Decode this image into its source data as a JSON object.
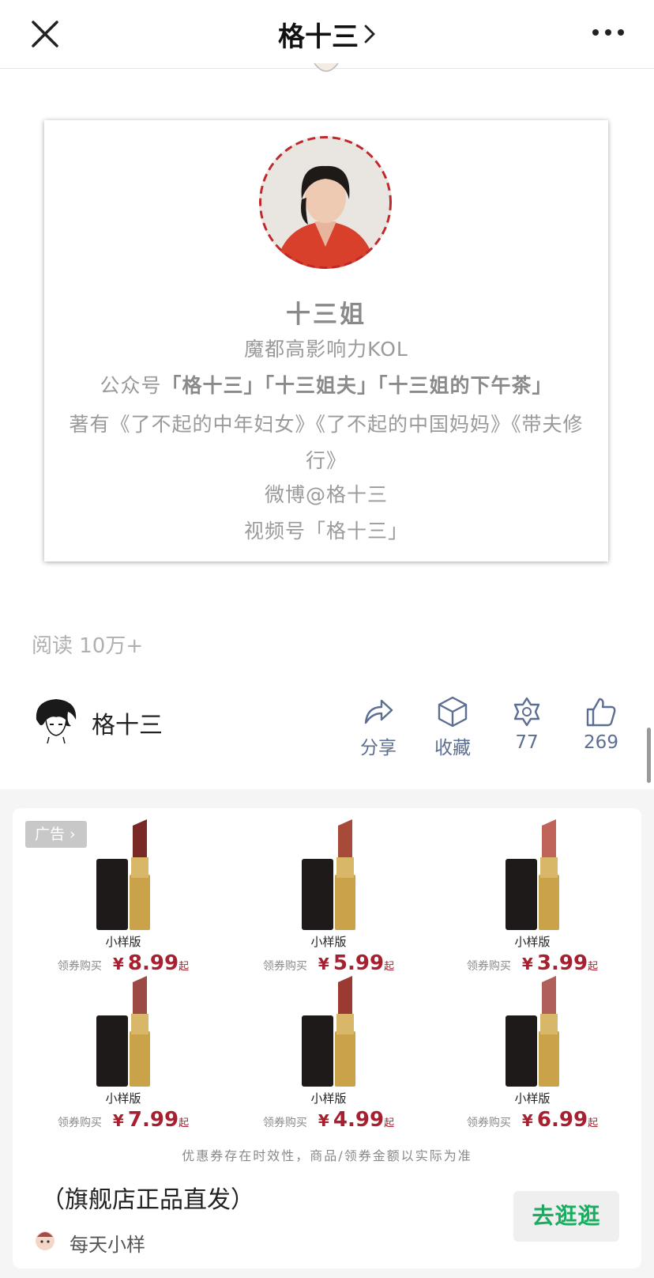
{
  "header": {
    "title": "格十三"
  },
  "profile_card": {
    "name": "十三姐",
    "line1": "魔都高影响力KOL",
    "line2_prefix": "公众号",
    "line2_accounts": "「格十三」「十三姐夫」「十三姐的下午茶」",
    "line3": "著有《了不起的中年妇女》《了不起的中国妈妈》《带夫修行》",
    "line5": "微博@格十三",
    "line6": "视频号「格十三」"
  },
  "article": {
    "read_count": "阅读 10万+"
  },
  "author": {
    "name": "格十三"
  },
  "actions": [
    {
      "label": "分享"
    },
    {
      "label": "收藏"
    },
    {
      "label": "77"
    },
    {
      "label": "269"
    }
  ],
  "ad": {
    "badge": "广告",
    "notice": "优惠券存在时效性，商品/领券金额以实际为准",
    "headline": "（旗舰店正品直发）",
    "brand": "每天小样",
    "cta": "去逛逛",
    "products": [
      {
        "tag": "小样版",
        "coupon": "领券购买",
        "yen": "¥",
        "price": "8.99",
        "suffix": "起",
        "color": "#7a2a26"
      },
      {
        "tag": "小样版",
        "coupon": "领券购买",
        "yen": "¥",
        "price": "5.99",
        "suffix": "起",
        "color": "#a84a3a"
      },
      {
        "tag": "小样版",
        "coupon": "领券购买",
        "yen": "¥",
        "price": "3.99",
        "suffix": "起",
        "color": "#c0645a"
      },
      {
        "tag": "小样版",
        "coupon": "领券购买",
        "yen": "¥",
        "price": "7.99",
        "suffix": "起",
        "color": "#9c4a44"
      },
      {
        "tag": "小样版",
        "coupon": "领券购买",
        "yen": "¥",
        "price": "4.99",
        "suffix": "起",
        "color": "#9a3a30"
      },
      {
        "tag": "小样版",
        "coupon": "领券购买",
        "yen": "¥",
        "price": "6.99",
        "suffix": "起",
        "color": "#b0605a"
      }
    ]
  },
  "colors": {
    "accent_red": "#a8202f",
    "link_blue": "#5c6e91",
    "cta_green": "#1aad62"
  }
}
